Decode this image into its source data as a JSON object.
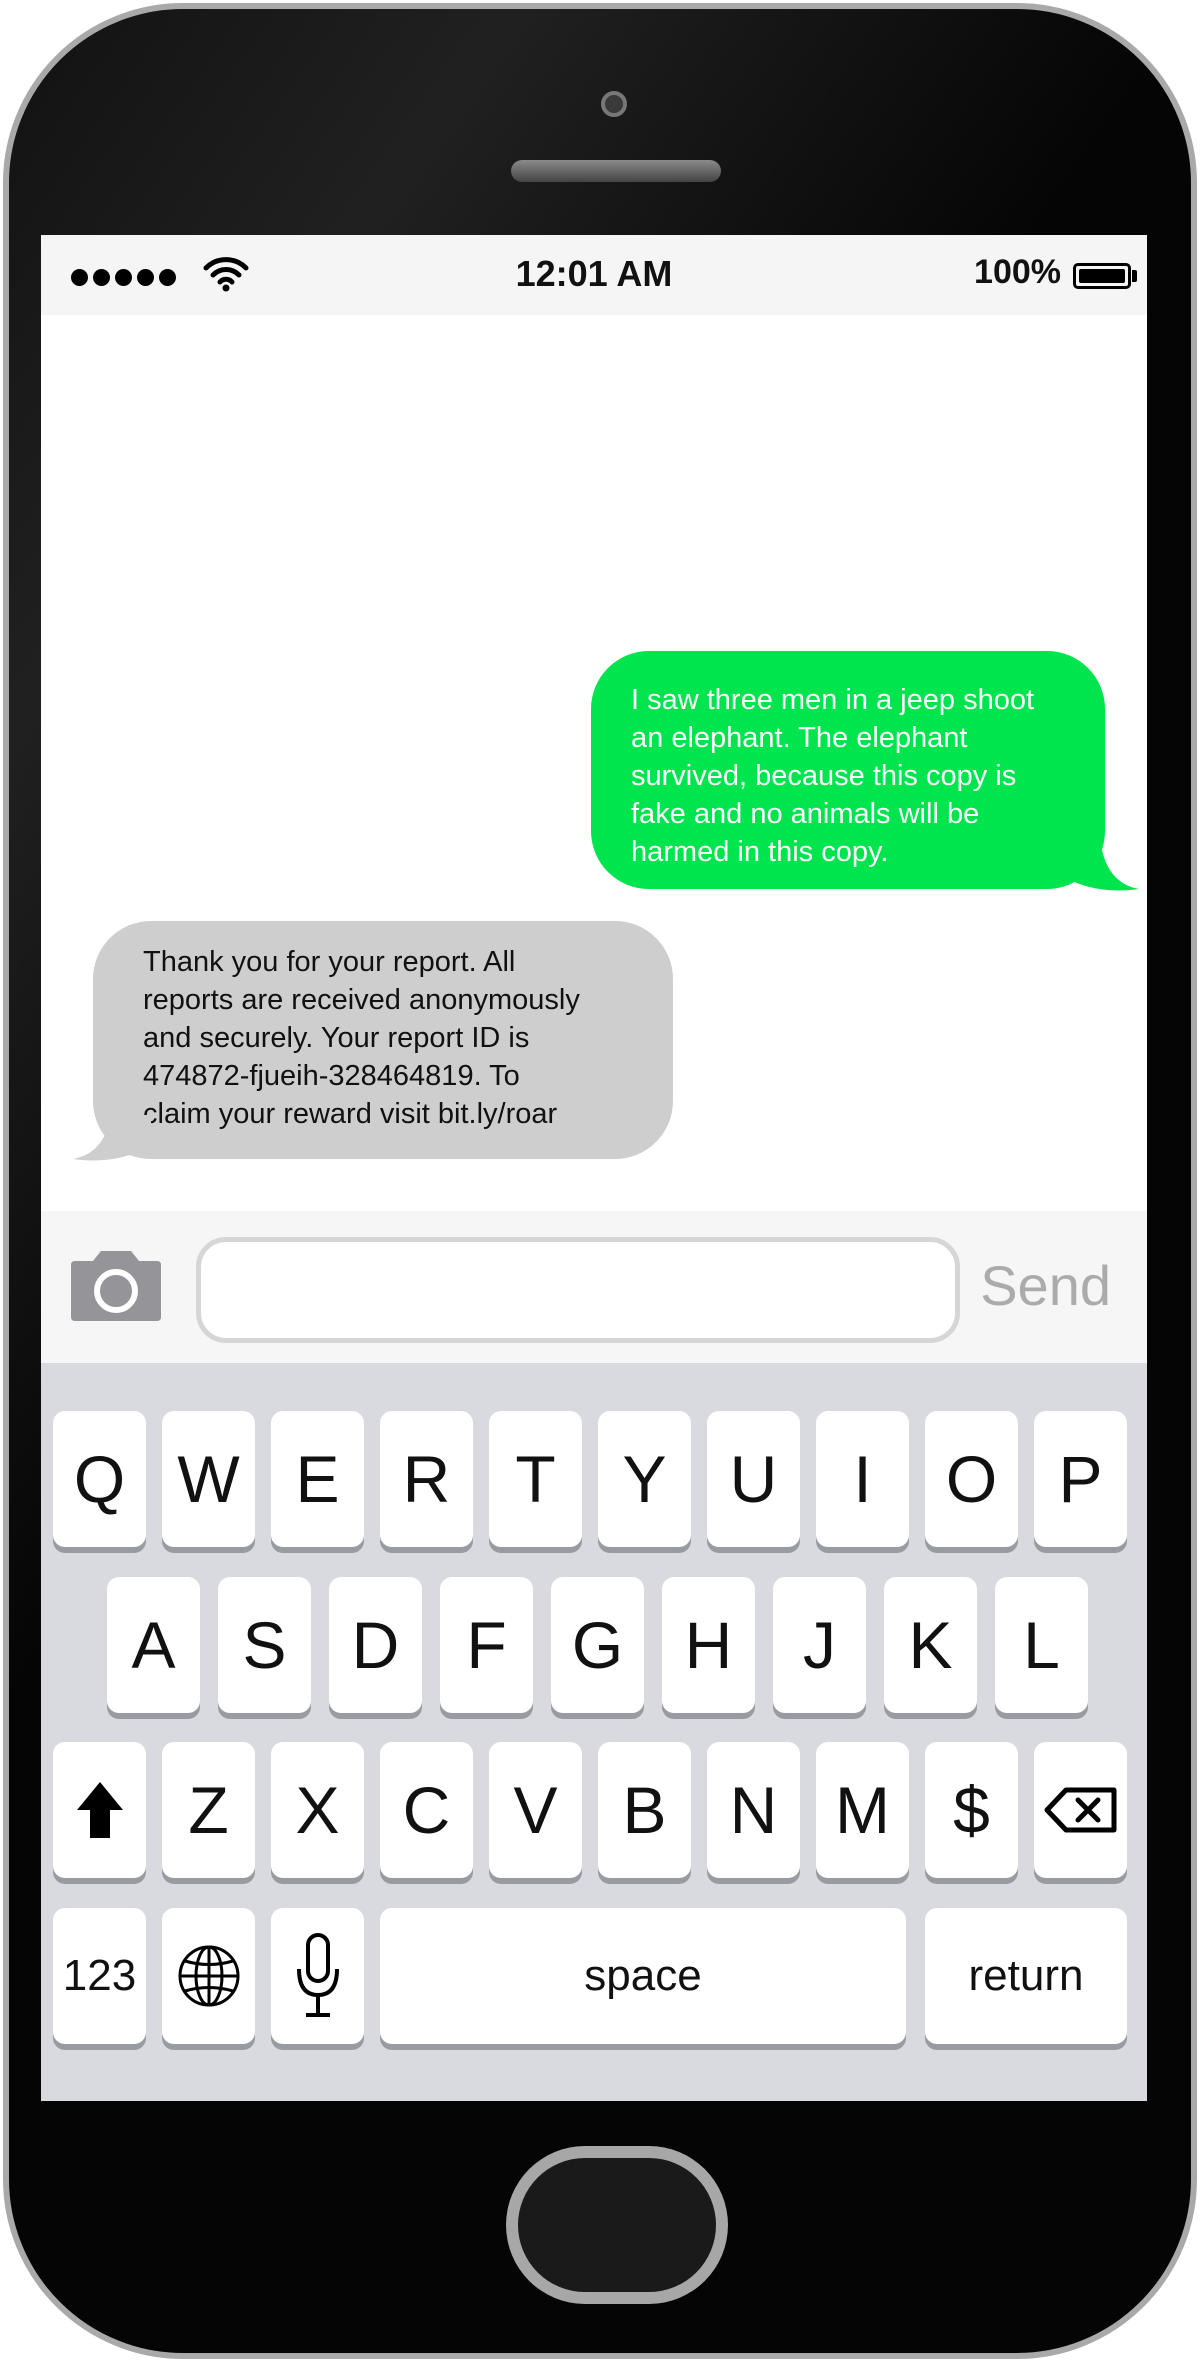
{
  "status_bar": {
    "time": "12:01 AM",
    "battery_percent": "100%",
    "signal_bars": 5,
    "icons": [
      "signal-dots-icon",
      "wifi-icon",
      "battery-full-icon"
    ]
  },
  "conversation": {
    "messages": [
      {
        "direction": "sent",
        "text": "I saw three men in a jeep shoot\nan elephant. The elephant\nsurvived, because this copy is\nfake and no animals will be\nharmed in this copy."
      },
      {
        "direction": "received",
        "text": "Thank you for your report. All\nreports are received anonymously\nand securely. Your report ID is\n474872-fjueih-328464819. To\nclaim your reward visit bit.ly/roar"
      }
    ],
    "colors": {
      "sent_bubble": "#00e44d",
      "received_bubble": "#cecece"
    }
  },
  "compose": {
    "input_value": "",
    "input_placeholder": "",
    "send_label": "Send",
    "camera_icon": "camera-icon"
  },
  "keyboard": {
    "row1": [
      "Q",
      "W",
      "E",
      "R",
      "T",
      "Y",
      "U",
      "I",
      "O",
      "P"
    ],
    "row2": [
      "A",
      "S",
      "D",
      "F",
      "G",
      "H",
      "J",
      "K",
      "L"
    ],
    "row3": [
      "Z",
      "X",
      "C",
      "V",
      "B",
      "N",
      "M",
      "$"
    ],
    "numbers_label": "123",
    "space_label": "space",
    "return_label": "return",
    "icons": [
      "shift-icon",
      "backspace-icon",
      "globe-icon",
      "microphone-icon"
    ]
  }
}
